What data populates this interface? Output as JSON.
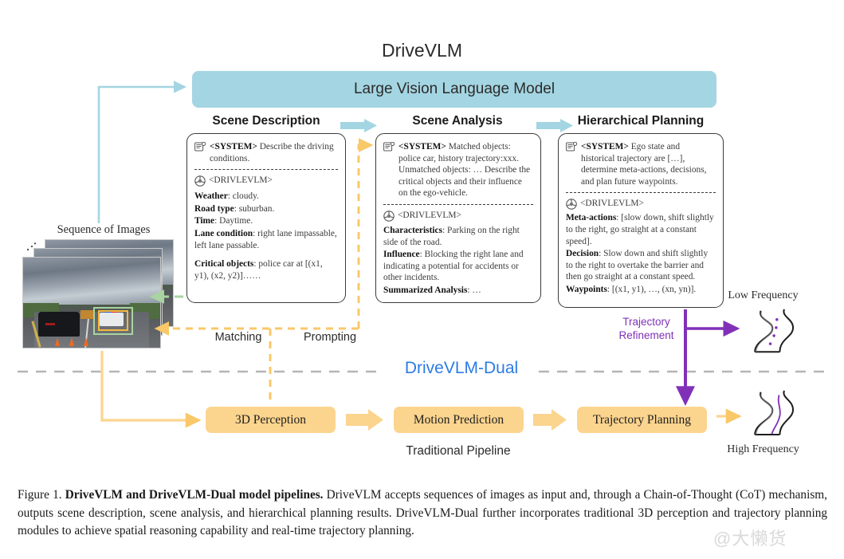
{
  "figure": {
    "title": "DriveVLM",
    "lvlm_bar_label": "Large Vision Language Model",
    "dual_label": "DriveVLM-Dual",
    "traditional_pipeline_label": "Traditional Pipeline",
    "sequence_label": "Sequence of Images",
    "matching_label": "Matching",
    "prompting_label": "Prompting",
    "trajectory_refinement_label": "Trajectory\nRefinement",
    "trajectory_refinement_line1": "Trajectory",
    "trajectory_refinement_line2": "Refinement",
    "low_frequency_label": "Low Frequency",
    "high_frequency_label": "High Frequency",
    "watermark": "@大懒货"
  },
  "colors": {
    "lvlm_bar": "#a4d5e2",
    "blue_arrow": "#a4d5e2",
    "orange_box": "#fbd48e",
    "orange_arrow": "#f9c869",
    "dual_text": "#2c7be5",
    "purple": "#8031b8",
    "green_arrow": "#a9d3a1",
    "dashed_gray": "#b5b5b5",
    "box_border": "#3a3a3a"
  },
  "columns": {
    "scene_description": "Scene Description",
    "scene_analysis": "Scene Analysis",
    "hierarchical_planning": "Hierarchical Planning"
  },
  "boxes": {
    "scene_description": {
      "system_role": "<SYSTEM>",
      "system_text": "Describe the driving conditions.",
      "model_role": "<DRIVLEVLM>",
      "fields": [
        {
          "key": "Weather",
          "value": ": cloudy."
        },
        {
          "key": "Road type",
          "value": ": suburban."
        },
        {
          "key": "Time",
          "value": ": Daytime."
        },
        {
          "key": "Lane condition",
          "value": ": right lane impassable, left lane passable."
        }
      ],
      "critical_key": "Critical objects",
      "critical_value": ": police car at [(x1, y1), (x2, y2)]……"
    },
    "scene_analysis": {
      "system_role": "<SYSTEM>",
      "system_text": "Matched objects: police car, history trajectory:xxx. Unmatched objects: … Describe the critical objects and their influence on the ego-vehicle.",
      "model_role": "<DRIVLEVLM>",
      "fields": [
        {
          "key": "Characteristics",
          "value": ": Parking on the right side of the road."
        },
        {
          "key": "Influence",
          "value": ": Blocking the right lane and indicating a potential for accidents or other incidents."
        },
        {
          "key": "Summarized Analysis",
          "value": ": …"
        }
      ]
    },
    "hierarchical_planning": {
      "system_role": "<SYSTEM>",
      "system_text": "Ego state and historical trajectory are […], determine meta-actions, decisions, and plan future waypoints.",
      "model_role": "<DRIVLEVLM>",
      "fields": [
        {
          "key": "Meta-actions",
          "value": ": [slow down, shift slightly to the right, go straight at a constant speed]."
        },
        {
          "key": "Decision",
          "value": ": Slow down and shift slightly to the right to overtake the barrier and then go straight at a constant speed."
        },
        {
          "key": "Waypoints",
          "value": ": [(x1, y1), …, (xn, yn)]."
        }
      ]
    }
  },
  "pipeline": {
    "perception": "3D Perception",
    "motion": "Motion Prediction",
    "planning": "Trajectory Planning"
  },
  "caption": {
    "prefix": "Figure 1. ",
    "bold": "DriveVLM and DriveVLM-Dual model pipelines.",
    "body": " DriveVLM accepts sequences of images as input and, through a Chain-of-Thought (CoT) mechanism, outputs scene description, scene analysis, and hierarchical planning results. DriveVLM-Dual further incorporates traditional 3D perception and trajectory planning modules to achieve spatial reasoning capability and real-time trajectory planning."
  },
  "icons": {
    "system": "system-document-icon",
    "model": "steering-wheel-icon",
    "road_low": "winding-road-dotted-icon",
    "road_high": "winding-road-solid-icon"
  }
}
